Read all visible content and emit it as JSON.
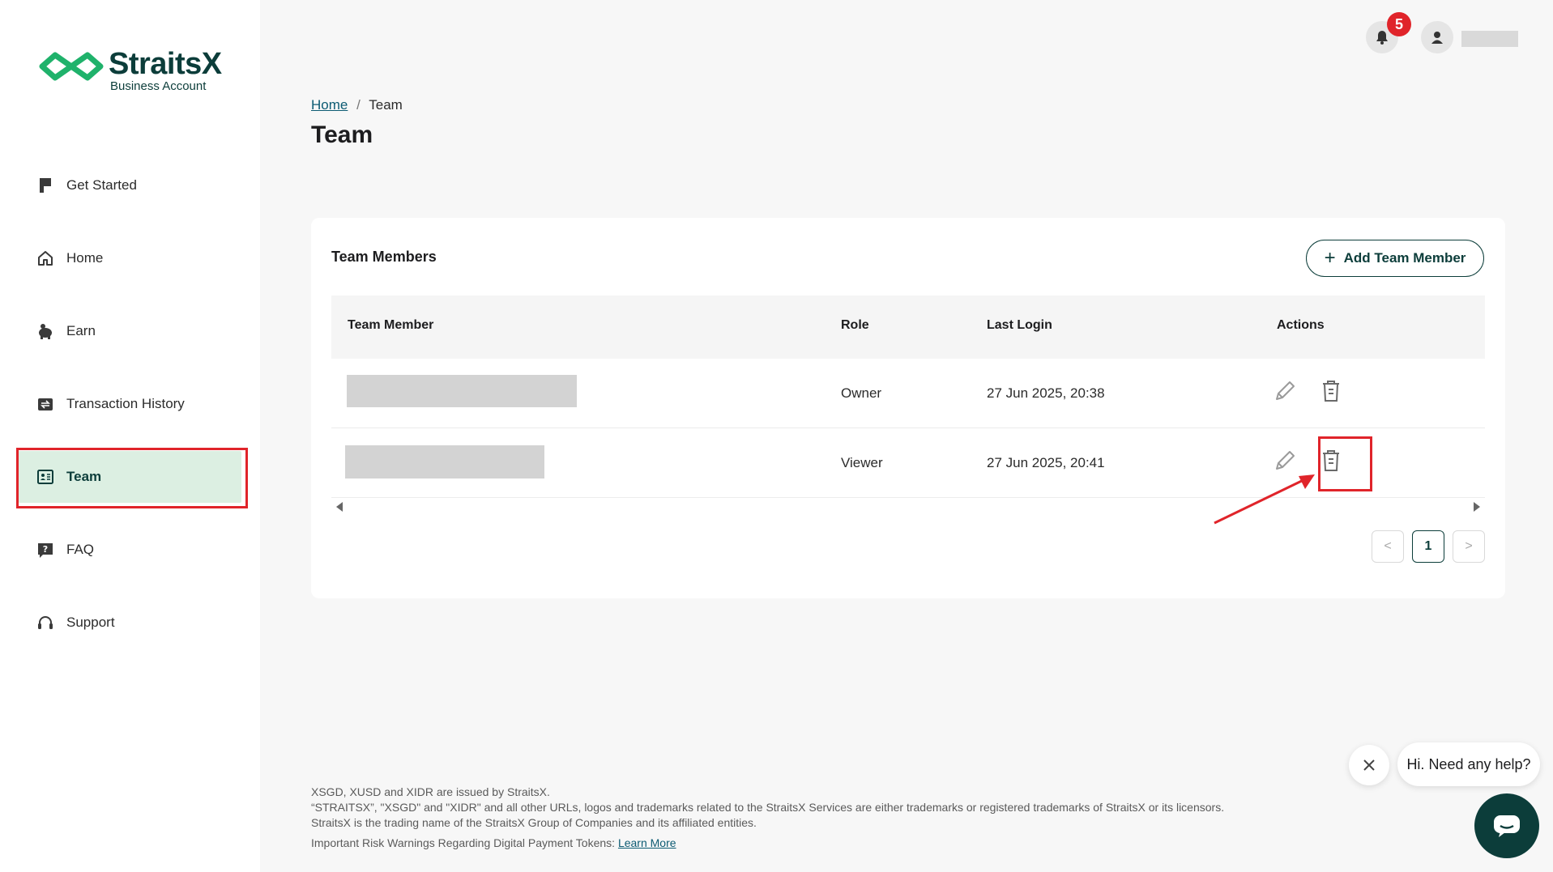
{
  "brand": {
    "name": "StraitsX",
    "subtitle": "Business Account"
  },
  "sidebar": {
    "items": [
      {
        "label": "Get Started",
        "icon": "flag-icon"
      },
      {
        "label": "Home",
        "icon": "home-icon"
      },
      {
        "label": "Earn",
        "icon": "piggy-bank-icon"
      },
      {
        "label": "Transaction History",
        "icon": "transaction-icon"
      },
      {
        "label": "Team",
        "icon": "id-card-icon",
        "active": true
      },
      {
        "label": "FAQ",
        "icon": "question-icon"
      },
      {
        "label": "Support",
        "icon": "headset-icon"
      }
    ]
  },
  "topbar": {
    "notifications_count": "5"
  },
  "breadcrumb": {
    "home": "Home",
    "separator": "/",
    "current": "Team"
  },
  "page_title": "Team",
  "card": {
    "title": "Team Members",
    "add_button": "Add Team Member",
    "columns": [
      "Team Member",
      "Role",
      "Last Login",
      "Actions"
    ],
    "rows": [
      {
        "role": "Owner",
        "last_login": "27 Jun 2025, 20:38"
      },
      {
        "role": "Viewer",
        "last_login": "27 Jun 2025, 20:41"
      }
    ],
    "pagination": {
      "prev": "<",
      "current": "1",
      "next": ">"
    }
  },
  "footer": {
    "line1": "XSGD, XUSD and XIDR are issued by StraitsX.",
    "line2": "“STRAITSX”, \"XSGD\" and \"XIDR\" and all other URLs, logos and trademarks related to the StraitsX Services are either trademarks or registered trademarks of StraitsX or its licensors.",
    "line3": "StraitsX is the trading name of the StraitsX Group of Companies and its affiliated entities.",
    "warning": "Important Risk Warnings Regarding Digital Payment Tokens:",
    "learn_more": "Learn More"
  },
  "help": {
    "bubble": "Hi. Need any help?"
  },
  "colors": {
    "brand_dark": "#0c3d3a",
    "brand_green": "#1fb26b",
    "active_bg": "#dcefe2",
    "highlight_red": "#e0242a"
  }
}
